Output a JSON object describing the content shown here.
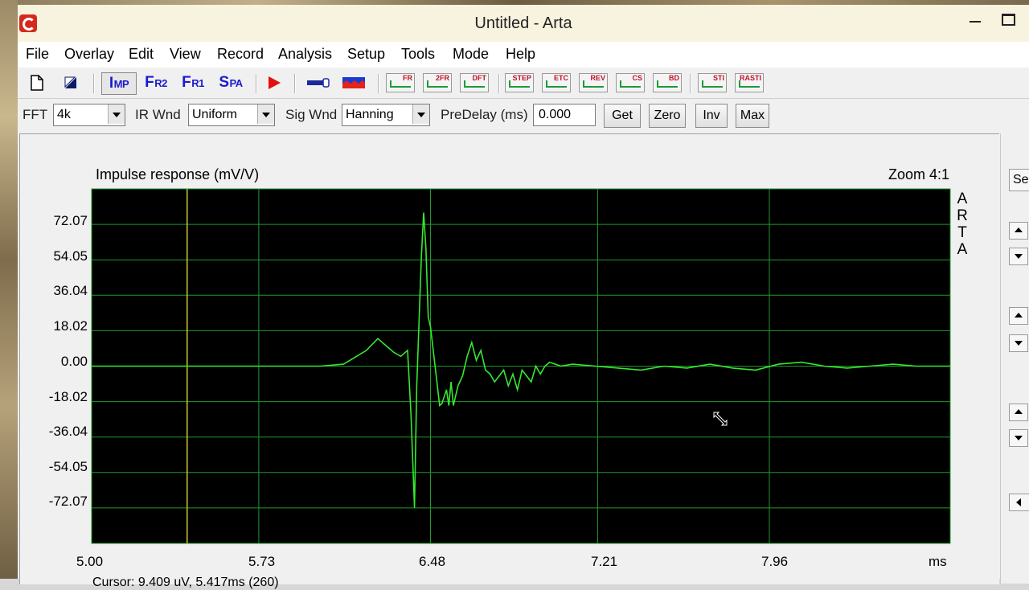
{
  "window": {
    "title": "Untitled - Arta"
  },
  "menu": [
    "File",
    "Overlay",
    "Edit",
    "View",
    "Record",
    "Analysis",
    "Setup",
    "Tools",
    "Mode",
    "Help"
  ],
  "toolbar": {
    "mode_buttons": [
      {
        "main": "I",
        "sub": "MP"
      },
      {
        "main": "F",
        "sub": "R2"
      },
      {
        "main": "F",
        "sub": "R1"
      },
      {
        "main": "S",
        "sub": "PA"
      }
    ],
    "graph_buttons": [
      "FR",
      "2FR",
      "DFT",
      "STEP",
      "ETC",
      "REV",
      "CS",
      "BD",
      "STI",
      "RASTI"
    ]
  },
  "params": {
    "fft_label": "FFT",
    "fft_value": "4k",
    "ir_wnd_label": "IR Wnd",
    "ir_wnd_value": "Uniform",
    "sig_wnd_label": "Sig Wnd",
    "sig_wnd_value": "Hanning",
    "predelay_label": "PreDelay (ms)",
    "predelay_value": "0.000",
    "get": "Get",
    "zero": "Zero",
    "inv": "Inv",
    "max": "Max"
  },
  "plot": {
    "title": "Impulse response (mV/V)",
    "zoom": "Zoom 4:1",
    "brand": "ARTA",
    "side_button": "Se",
    "cursor_text": "Cursor: 9.409 uV, 5.417ms (260)"
  },
  "chart_data": {
    "type": "line",
    "title": "Impulse response (mV/V)",
    "xlabel": "ms",
    "ylabel": "",
    "xlim": [
      5.0,
      8.75
    ],
    "ylim": [
      -90.09,
      90.09
    ],
    "x_ticks": [
      "5.00",
      "5.73",
      "6.48",
      "7.21",
      "7.96",
      "ms"
    ],
    "y_ticks": [
      "72.07",
      "54.05",
      "36.04",
      "18.02",
      "0.00",
      "-18.02",
      "-36.04",
      "-54.05",
      "-72.07"
    ],
    "grid": true,
    "colors": {
      "background": "#000000",
      "grid": "#1f9a2c",
      "trace": "#35e82f",
      "cursor": "#c8c82a"
    },
    "cursor_x": 5.417,
    "series": [
      {
        "x": [
          5.0,
          5.25,
          5.5,
          5.75,
          6.0,
          6.1,
          6.2,
          6.25,
          6.28,
          6.3,
          6.32,
          6.35,
          6.38,
          6.395,
          6.41,
          6.42,
          6.44,
          6.45,
          6.46,
          6.47,
          6.48,
          6.5,
          6.52,
          6.53,
          6.55,
          6.56,
          6.57,
          6.58,
          6.6,
          6.62,
          6.64,
          6.66,
          6.68,
          6.7,
          6.72,
          6.74,
          6.76,
          6.78,
          6.8,
          6.82,
          6.84,
          6.86,
          6.88,
          6.9,
          6.92,
          6.94,
          6.96,
          6.98,
          7.0,
          7.05,
          7.1,
          7.2,
          7.3,
          7.4,
          7.5,
          7.6,
          7.7,
          7.8,
          7.9,
          8.0,
          8.1,
          8.2,
          8.3,
          8.4,
          8.5,
          8.6,
          8.75
        ],
        "y": [
          0,
          0,
          0,
          0,
          0,
          1,
          8,
          14,
          11,
          9,
          7,
          5,
          8,
          -25,
          -72,
          -10,
          55,
          78,
          60,
          25,
          20,
          0,
          -20,
          -19,
          -12,
          -20,
          -8,
          -20,
          -10,
          -5,
          5,
          12,
          3,
          8,
          -2,
          -4,
          -8,
          -5,
          -2,
          -10,
          -4,
          -12,
          -2,
          -5,
          -8,
          0,
          -4,
          0,
          2,
          0,
          1,
          0,
          -1,
          -2,
          0,
          -1,
          1,
          -1,
          -2,
          1,
          2,
          0,
          -1,
          0,
          1,
          0,
          0
        ]
      }
    ]
  }
}
